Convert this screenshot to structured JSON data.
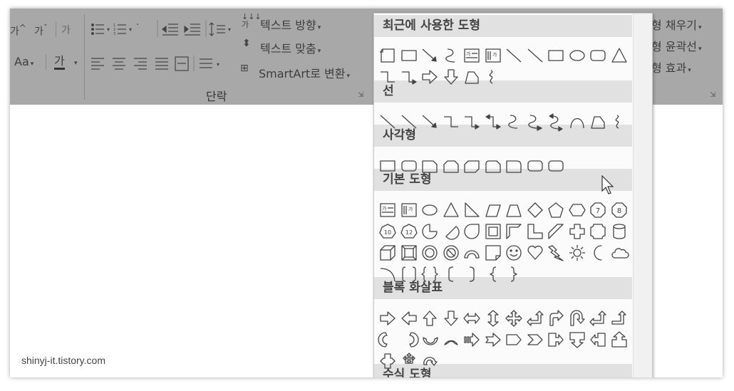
{
  "ribbon": {
    "font_size_increase": "가",
    "font_size_decrease": "가",
    "clear_format": "가",
    "case_label": "Aa",
    "font_color_char": "가",
    "text_direction": "텍스트 방향",
    "text_align": "텍스트 맞춤",
    "smartart": "SmartArt로 변환",
    "text_direction_icon": "가",
    "group_label": "단락",
    "shape_fill": "형 채우기",
    "shape_outline": "형 윤곽선",
    "shape_effects": "형 효과"
  },
  "gallery": {
    "sections": [
      {
        "title": "최근에 사용한 도형"
      },
      {
        "title": "선"
      },
      {
        "title": "사각형"
      },
      {
        "title": "기본 도형"
      },
      {
        "title": "블록 화살표"
      },
      {
        "title": "수식 도형"
      }
    ],
    "textbox_glyph": "가",
    "octagon_numbers": [
      "7",
      "8",
      "10",
      "12"
    ]
  },
  "watermark": "shinyj-it.tistory.com"
}
